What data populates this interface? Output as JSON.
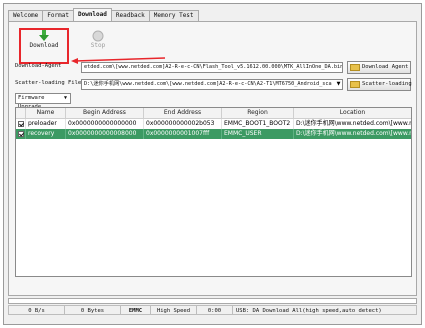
{
  "tabs": [
    "Welcome",
    "Format",
    "Download",
    "Readback",
    "Memory Test"
  ],
  "active_tab": 2,
  "toolbar": {
    "download_label": "Download",
    "stop_label": "Stop"
  },
  "download_agent": {
    "label": "Download-Agent",
    "value": "etded.com\\[www.netded.com]A2-R-e-c-CN\\Flash_Tool_v5.1612.00.000\\MTK_AllInOne_DA.bin",
    "button": "Download Agent"
  },
  "scatter": {
    "label": "Scatter-loading File",
    "value": "D:\\迷你手机网\\www.netded.com\\[www.netded.com]A2-R-e-c-CN\\A2-T1\\MT6750_Android_sca",
    "button": "Scatter-loading"
  },
  "mode_select": "Firmware Upgrade",
  "table": {
    "headers": [
      "",
      "Name",
      "Begin Address",
      "End Address",
      "Region",
      "Location"
    ],
    "rows": [
      {
        "checked": true,
        "name": "preloader",
        "begin": "0x0000000000000000",
        "end": "0x000000000002b053",
        "region": "EMMC_BOOT1_BOOT2",
        "location": "D:\\迷你手机网\\www.netded.com\\[www.n..."
      },
      {
        "checked": true,
        "name": "recovery",
        "begin": "0x0000000000008000",
        "end": "0x0000000001007fff",
        "region": "EMMC_USER",
        "location": "D:\\迷你手机网\\www.netded.com\\[www.n..."
      }
    ]
  },
  "status": {
    "speed": "0 B/s",
    "bytes": "0 Bytes",
    "storage": "EMMC",
    "mode": "High Speed",
    "time": "0:00",
    "info": "USB: DA Download All(high speed,auto detect)"
  },
  "colors": {
    "selected_row": "#3c9a63",
    "highlight_box": "#e8262b"
  }
}
